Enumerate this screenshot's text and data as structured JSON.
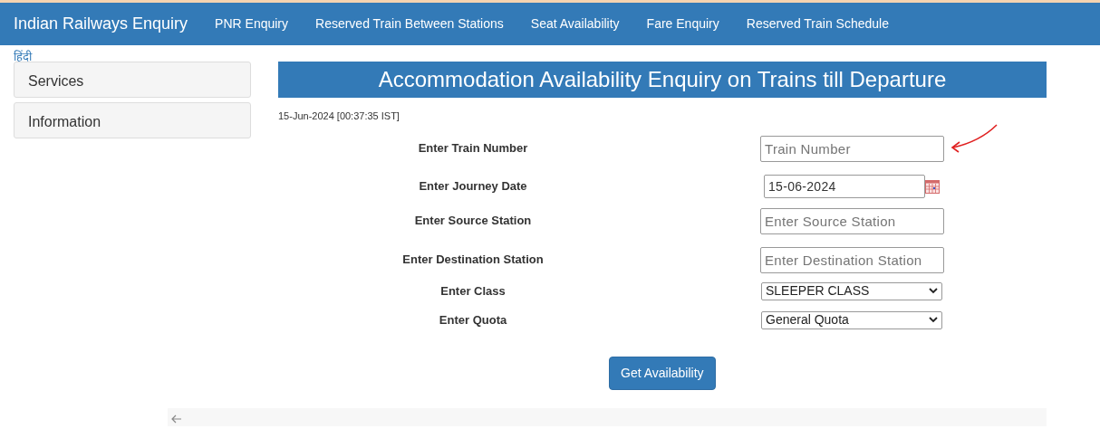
{
  "navbar": {
    "brand": "Indian Railways Enquiry",
    "links": [
      {
        "label": "PNR Enquiry"
      },
      {
        "label": "Reserved Train Between Stations"
      },
      {
        "label": "Seat Availability"
      },
      {
        "label": "Fare Enquiry"
      },
      {
        "label": "Reserved Train Schedule"
      }
    ]
  },
  "language_link": "हिंदी",
  "sidebar": {
    "items": [
      {
        "label": "Services"
      },
      {
        "label": "Information"
      }
    ]
  },
  "main": {
    "title": "Accommodation Availability Enquiry on Trains till Departure",
    "timestamp": "15-Jun-2024 [00:37:35 IST]",
    "fields": [
      {
        "kind": "text",
        "label": "Enter Train Number",
        "placeholder": "Train Number",
        "annotated": true
      },
      {
        "kind": "date",
        "label": "Enter Journey Date",
        "value": "15-06-2024"
      },
      {
        "kind": "text",
        "label": "Enter Source Station",
        "placeholder": "Enter Source Station"
      },
      {
        "kind": "text",
        "label": "Enter Destination Station",
        "placeholder": "Enter Destination Station"
      },
      {
        "kind": "select",
        "label": "Enter Class",
        "value": "SLEEPER CLASS"
      },
      {
        "kind": "select",
        "label": "Enter Quota",
        "value": "General Quota"
      }
    ],
    "submit": "Get Availability"
  }
}
